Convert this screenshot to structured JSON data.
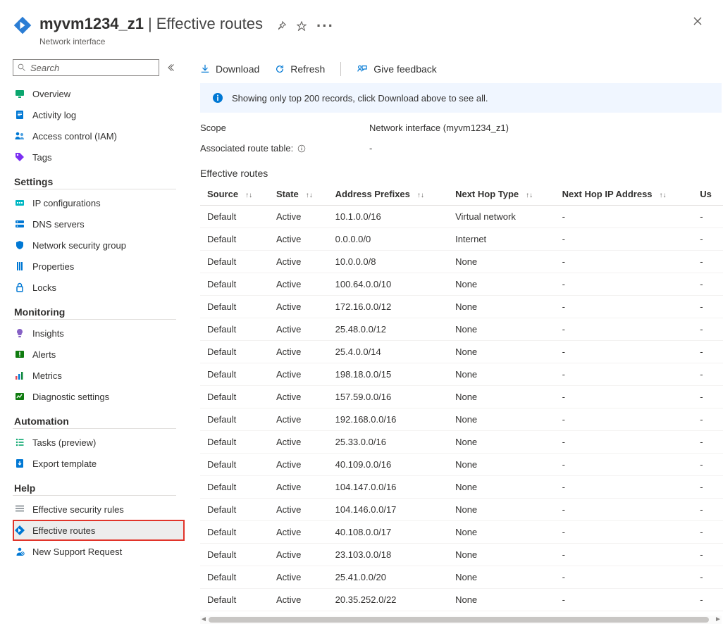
{
  "header": {
    "resource_name": "myvm1234_z1",
    "page_title": "Effective routes",
    "subtitle": "Network interface"
  },
  "search": {
    "placeholder": "Search"
  },
  "sidebar": {
    "top": [
      {
        "label": "Overview",
        "icon": "monitor",
        "color": "#0aa66e"
      },
      {
        "label": "Activity log",
        "icon": "log",
        "color": "#0078d4"
      },
      {
        "label": "Access control (IAM)",
        "icon": "iam",
        "color": "#0078d4"
      },
      {
        "label": "Tags",
        "icon": "tag",
        "color": "#7b2ff2"
      }
    ],
    "settings_title": "Settings",
    "settings": [
      {
        "label": "IP configurations",
        "icon": "ip",
        "color": "#00b7c3"
      },
      {
        "label": "DNS servers",
        "icon": "dns",
        "color": "#0078d4"
      },
      {
        "label": "Network security group",
        "icon": "shield",
        "color": "#0078d4"
      },
      {
        "label": "Properties",
        "icon": "props",
        "color": "#0078d4"
      },
      {
        "label": "Locks",
        "icon": "lock",
        "color": "#0078d4"
      }
    ],
    "monitoring_title": "Monitoring",
    "monitoring": [
      {
        "label": "Insights",
        "icon": "bulb",
        "color": "#8661c5"
      },
      {
        "label": "Alerts",
        "icon": "alert",
        "color": "#107c10"
      },
      {
        "label": "Metrics",
        "icon": "metrics",
        "color": "#0078d4"
      },
      {
        "label": "Diagnostic settings",
        "icon": "diag",
        "color": "#107c10"
      }
    ],
    "automation_title": "Automation",
    "automation": [
      {
        "label": "Tasks (preview)",
        "icon": "tasks",
        "color": "#0aa66e"
      },
      {
        "label": "Export template",
        "icon": "export",
        "color": "#0078d4"
      }
    ],
    "help_title": "Help",
    "help": [
      {
        "label": "Effective security rules",
        "icon": "secrules",
        "color": "#9aa0a6",
        "active": false
      },
      {
        "label": "Effective routes",
        "icon": "routes",
        "color": "#0078d4",
        "active": true,
        "highlight": true
      },
      {
        "label": "New Support Request",
        "icon": "support",
        "color": "#0078d4",
        "active": false
      }
    ]
  },
  "toolbar": {
    "download": "Download",
    "refresh": "Refresh",
    "feedback": "Give feedback"
  },
  "banner": "Showing only top 200 records, click Download above to see all.",
  "scope": {
    "label": "Scope",
    "value": "Network interface (myvm1234_z1)"
  },
  "assoc": {
    "label": "Associated route table:",
    "value": "-"
  },
  "table": {
    "title": "Effective routes",
    "columns": [
      "Source",
      "State",
      "Address Prefixes",
      "Next Hop Type",
      "Next Hop IP Address",
      "Us"
    ],
    "rows": [
      {
        "source": "Default",
        "state": "Active",
        "prefix": "10.1.0.0/16",
        "hop": "Virtual network",
        "ip": "-",
        "us": "-"
      },
      {
        "source": "Default",
        "state": "Active",
        "prefix": "0.0.0.0/0",
        "hop": "Internet",
        "ip": "-",
        "us": "-"
      },
      {
        "source": "Default",
        "state": "Active",
        "prefix": "10.0.0.0/8",
        "hop": "None",
        "ip": "-",
        "us": "-"
      },
      {
        "source": "Default",
        "state": "Active",
        "prefix": "100.64.0.0/10",
        "hop": "None",
        "ip": "-",
        "us": "-"
      },
      {
        "source": "Default",
        "state": "Active",
        "prefix": "172.16.0.0/12",
        "hop": "None",
        "ip": "-",
        "us": "-"
      },
      {
        "source": "Default",
        "state": "Active",
        "prefix": "25.48.0.0/12",
        "hop": "None",
        "ip": "-",
        "us": "-"
      },
      {
        "source": "Default",
        "state": "Active",
        "prefix": "25.4.0.0/14",
        "hop": "None",
        "ip": "-",
        "us": "-"
      },
      {
        "source": "Default",
        "state": "Active",
        "prefix": "198.18.0.0/15",
        "hop": "None",
        "ip": "-",
        "us": "-"
      },
      {
        "source": "Default",
        "state": "Active",
        "prefix": "157.59.0.0/16",
        "hop": "None",
        "ip": "-",
        "us": "-"
      },
      {
        "source": "Default",
        "state": "Active",
        "prefix": "192.168.0.0/16",
        "hop": "None",
        "ip": "-",
        "us": "-"
      },
      {
        "source": "Default",
        "state": "Active",
        "prefix": "25.33.0.0/16",
        "hop": "None",
        "ip": "-",
        "us": "-"
      },
      {
        "source": "Default",
        "state": "Active",
        "prefix": "40.109.0.0/16",
        "hop": "None",
        "ip": "-",
        "us": "-"
      },
      {
        "source": "Default",
        "state": "Active",
        "prefix": "104.147.0.0/16",
        "hop": "None",
        "ip": "-",
        "us": "-"
      },
      {
        "source": "Default",
        "state": "Active",
        "prefix": "104.146.0.0/17",
        "hop": "None",
        "ip": "-",
        "us": "-"
      },
      {
        "source": "Default",
        "state": "Active",
        "prefix": "40.108.0.0/17",
        "hop": "None",
        "ip": "-",
        "us": "-"
      },
      {
        "source": "Default",
        "state": "Active",
        "prefix": "23.103.0.0/18",
        "hop": "None",
        "ip": "-",
        "us": "-"
      },
      {
        "source": "Default",
        "state": "Active",
        "prefix": "25.41.0.0/20",
        "hop": "None",
        "ip": "-",
        "us": "-"
      },
      {
        "source": "Default",
        "state": "Active",
        "prefix": "20.35.252.0/22",
        "hop": "None",
        "ip": "-",
        "us": "-"
      }
    ]
  }
}
